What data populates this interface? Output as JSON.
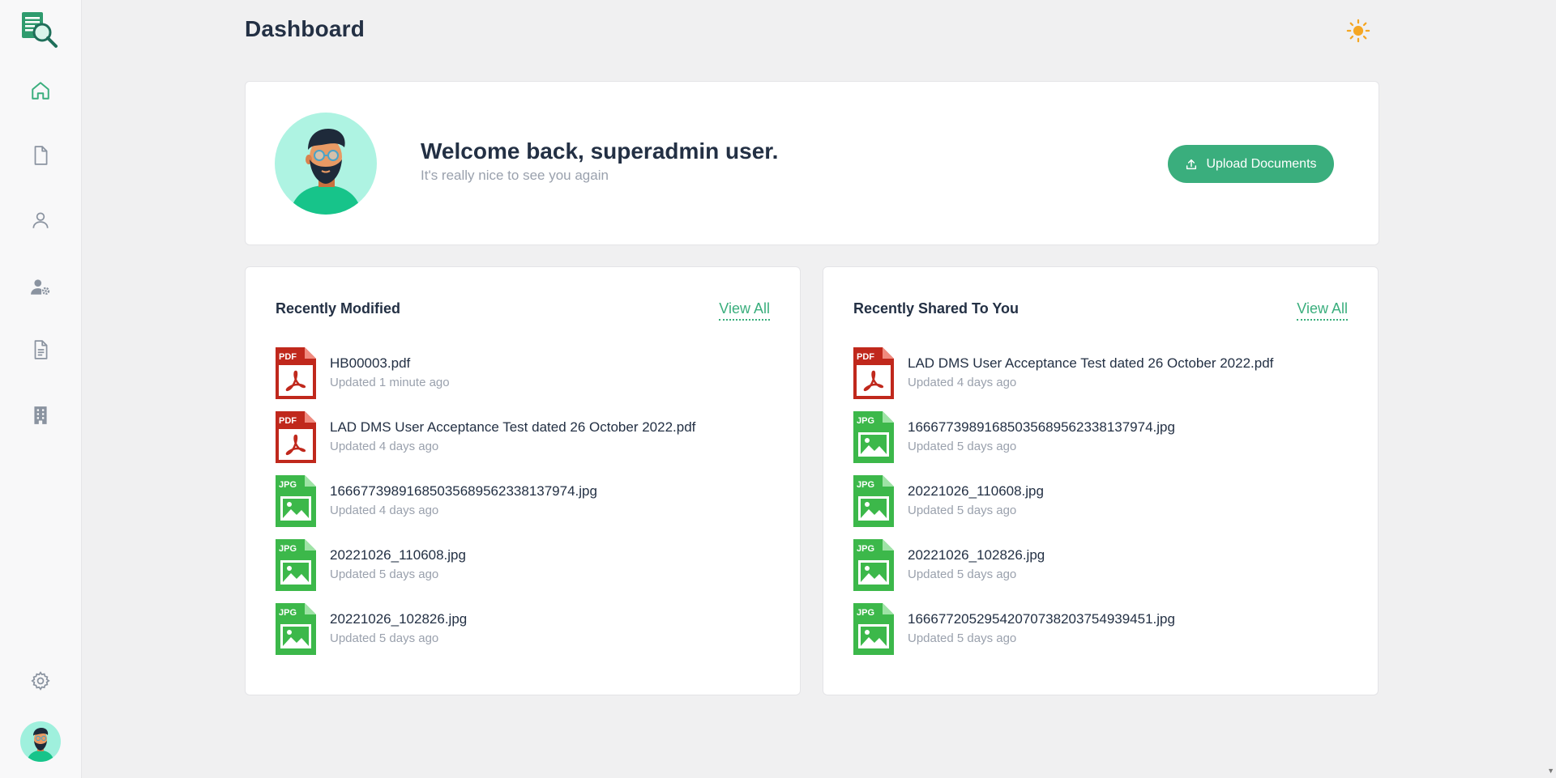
{
  "page": {
    "title": "Dashboard"
  },
  "colors": {
    "accent": "#3aae7d",
    "pdf": "#c0281c",
    "jpg": "#3cb84a",
    "sun": "#f5a623"
  },
  "sidebar": {
    "logo": "document-search-logo-icon",
    "items": [
      {
        "name": "home",
        "icon": "home-icon",
        "active": true
      },
      {
        "name": "documents",
        "icon": "file-icon",
        "active": false
      },
      {
        "name": "users",
        "icon": "user-icon",
        "active": false
      },
      {
        "name": "user-settings",
        "icon": "user-gear-icon",
        "active": false
      },
      {
        "name": "reports",
        "icon": "file-text-icon",
        "active": false
      },
      {
        "name": "organization",
        "icon": "building-icon",
        "active": false
      }
    ],
    "settings_icon": "gear-icon",
    "avatar": "user-avatar"
  },
  "welcome": {
    "title": "Welcome back, superadmin user.",
    "subtitle": "It's really nice to see you again",
    "upload_label": "Upload Documents"
  },
  "recently_modified": {
    "title": "Recently Modified",
    "view_all": "View All",
    "files": [
      {
        "name": "HB00003.pdf",
        "type": "pdf",
        "updated": "Updated 1 minute ago"
      },
      {
        "name": "LAD DMS User Acceptance Test dated 26 October 2022.pdf",
        "type": "pdf",
        "updated": "Updated 4 days ago"
      },
      {
        "name": "16667739891685035689562338137974.jpg",
        "type": "jpg",
        "updated": "Updated 4 days ago"
      },
      {
        "name": "20221026_110608.jpg",
        "type": "jpg",
        "updated": "Updated 5 days ago"
      },
      {
        "name": "20221026_102826.jpg",
        "type": "jpg",
        "updated": "Updated 5 days ago"
      }
    ]
  },
  "recently_shared": {
    "title": "Recently Shared To You",
    "view_all": "View All",
    "files": [
      {
        "name": "LAD DMS User Acceptance Test dated 26 October 2022.pdf",
        "type": "pdf",
        "updated": "Updated 4 days ago"
      },
      {
        "name": "16667739891685035689562338137974.jpg",
        "type": "jpg",
        "updated": "Updated 5 days ago"
      },
      {
        "name": "20221026_110608.jpg",
        "type": "jpg",
        "updated": "Updated 5 days ago"
      },
      {
        "name": "20221026_102826.jpg",
        "type": "jpg",
        "updated": "Updated 5 days ago"
      },
      {
        "name": "16667720529542070738203754939451.jpg",
        "type": "jpg",
        "updated": "Updated 5 days ago"
      }
    ]
  }
}
